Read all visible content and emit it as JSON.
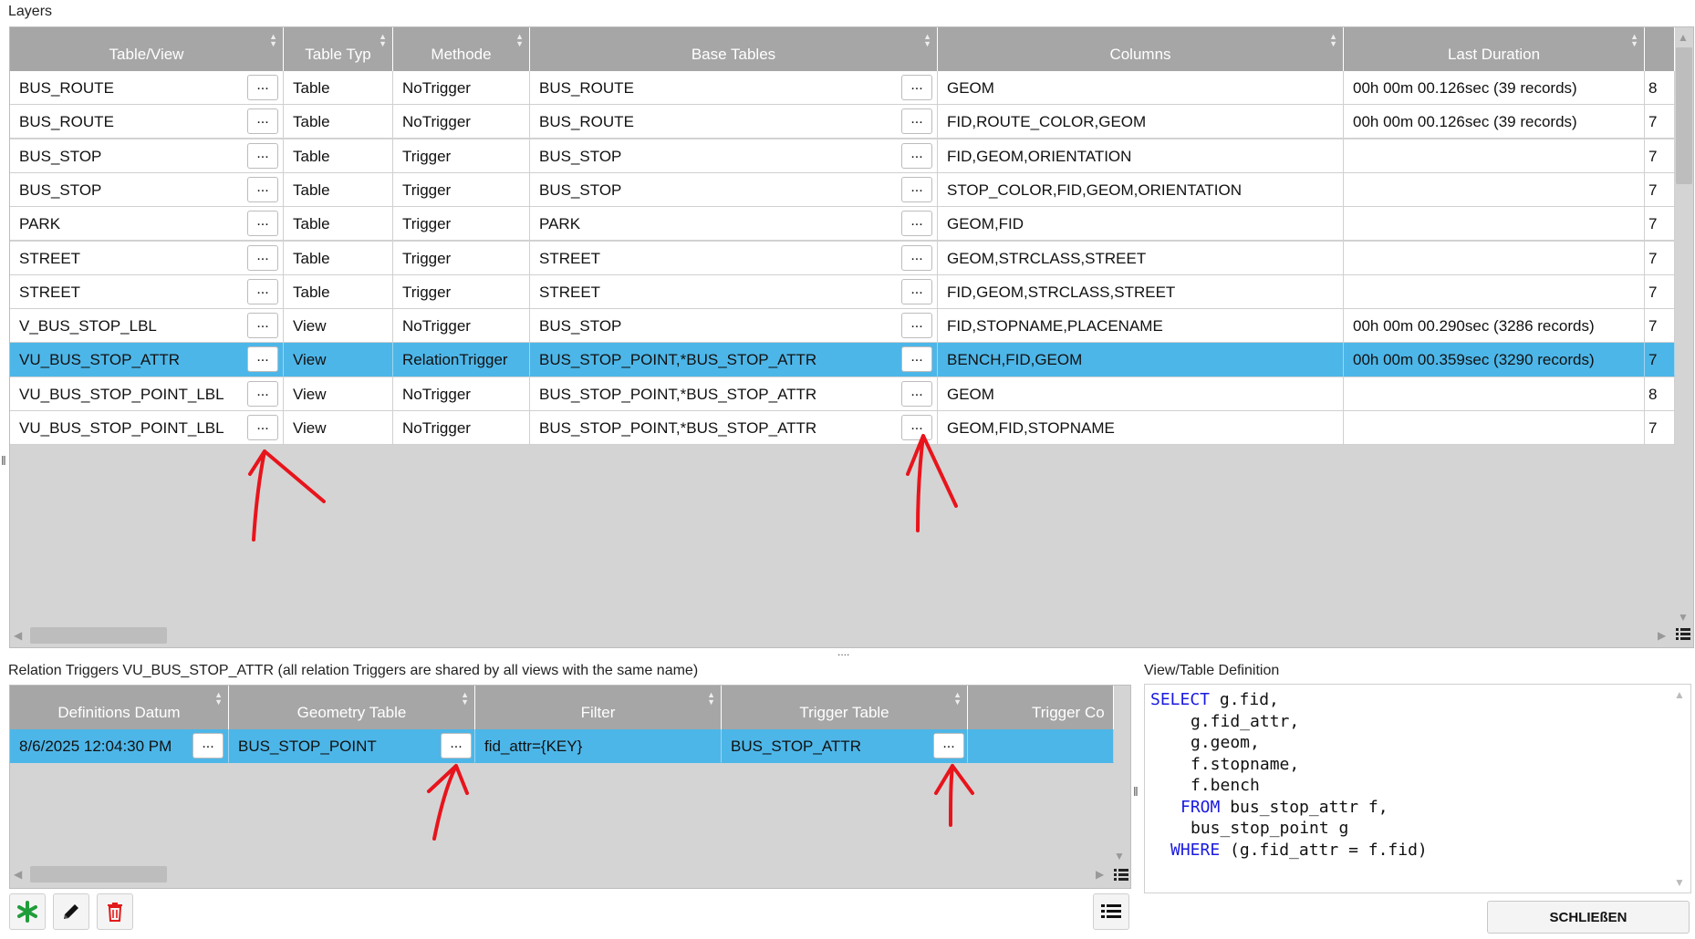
{
  "layers_label": "Layers",
  "layers_table": {
    "columns": [
      "Table/View",
      "Table Typ",
      "Methode",
      "Base Tables",
      "Columns",
      "Last Duration"
    ],
    "rows": [
      {
        "table_view": "BUS_ROUTE",
        "typ": "Table",
        "methode": "NoTrigger",
        "base_tables": "BUS_ROUTE",
        "columns": "GEOM",
        "duration": "00h 00m 00.126sec (39 records)",
        "extra": "8"
      },
      {
        "table_view": "BUS_ROUTE",
        "typ": "Table",
        "methode": "NoTrigger",
        "base_tables": "BUS_ROUTE",
        "columns": "FID,ROUTE_COLOR,GEOM",
        "duration": "00h 00m 00.126sec (39 records)",
        "extra": "7"
      },
      {
        "table_view": "BUS_STOP",
        "typ": "Table",
        "methode": "Trigger",
        "base_tables": "BUS_STOP",
        "columns": "FID,GEOM,ORIENTATION",
        "duration": "",
        "extra": "7"
      },
      {
        "table_view": "BUS_STOP",
        "typ": "Table",
        "methode": "Trigger",
        "base_tables": "BUS_STOP",
        "columns": "STOP_COLOR,FID,GEOM,ORIENTATION",
        "duration": "",
        "extra": "7"
      },
      {
        "table_view": "PARK",
        "typ": "Table",
        "methode": "Trigger",
        "base_tables": "PARK",
        "columns": "GEOM,FID",
        "duration": "",
        "extra": "7"
      },
      {
        "table_view": "STREET",
        "typ": "Table",
        "methode": "Trigger",
        "base_tables": "STREET",
        "columns": "GEOM,STRCLASS,STREET",
        "duration": "",
        "extra": "7"
      },
      {
        "table_view": "STREET",
        "typ": "Table",
        "methode": "Trigger",
        "base_tables": "STREET",
        "columns": "FID,GEOM,STRCLASS,STREET",
        "duration": "",
        "extra": "7"
      },
      {
        "table_view": "V_BUS_STOP_LBL",
        "typ": "View",
        "methode": "NoTrigger",
        "base_tables": "BUS_STOP",
        "columns": "FID,STOPNAME,PLACENAME",
        "duration": "00h 00m 00.290sec (3286 records)",
        "extra": "7"
      },
      {
        "table_view": "VU_BUS_STOP_ATTR",
        "typ": "View",
        "methode": "RelationTrigger",
        "base_tables": "BUS_STOP_POINT,*BUS_STOP_ATTR",
        "columns": "BENCH,FID,GEOM",
        "duration": "00h 00m 00.359sec (3290 records)",
        "extra": "7",
        "selected": true
      },
      {
        "table_view": "VU_BUS_STOP_POINT_LBL",
        "typ": "View",
        "methode": "NoTrigger",
        "base_tables": "BUS_STOP_POINT,*BUS_STOP_ATTR",
        "columns": "GEOM",
        "duration": "",
        "extra": "8"
      },
      {
        "table_view": "VU_BUS_STOP_POINT_LBL",
        "typ": "View",
        "methode": "NoTrigger",
        "base_tables": "BUS_STOP_POINT,*BUS_STOP_ATTR",
        "columns": "GEOM,FID,STOPNAME",
        "duration": "",
        "extra": "7"
      }
    ],
    "button_label": "..."
  },
  "splitter_label": "....",
  "relation_label": "Relation Triggers VU_BUS_STOP_ATTR (all relation Triggers are shared by all views with the same name)",
  "relation_table": {
    "columns": [
      "Definitions Datum",
      "Geometry Table",
      "Filter",
      "Trigger Table",
      "Trigger Co"
    ],
    "rows": [
      {
        "datum": "8/6/2025 12:04:30 PM",
        "geometry": "BUS_STOP_POINT",
        "filter": "fid_attr={KEY}",
        "trigger_table": "BUS_STOP_ATTR",
        "trigger_co": "",
        "selected": true
      }
    ]
  },
  "definition_label": "View/Table Definition",
  "definition_sql": [
    {
      "indent": 0,
      "kw": "SELECT",
      "text": " g.fid,"
    },
    {
      "indent": 4,
      "kw": "",
      "text": "g.fid_attr,"
    },
    {
      "indent": 4,
      "kw": "",
      "text": "g.geom,"
    },
    {
      "indent": 4,
      "kw": "",
      "text": "f.stopname,"
    },
    {
      "indent": 4,
      "kw": "",
      "text": "f.bench"
    },
    {
      "indent": 3,
      "kw": "FROM",
      "text": " bus_stop_attr f,"
    },
    {
      "indent": 4,
      "kw": "",
      "text": "bus_stop_point g"
    },
    {
      "indent": 2,
      "kw": "WHERE",
      "text": " (g.fid_attr = f.fid)"
    }
  ],
  "close_button": "SCHLIEßEN",
  "colors": {
    "selection": "#4db6e8",
    "header": "#a6a6a6",
    "annotation": "#e8141c",
    "keyword": "#1a1ae0"
  },
  "icons": [
    "add-icon",
    "edit-icon",
    "delete-icon",
    "list-icon"
  ]
}
